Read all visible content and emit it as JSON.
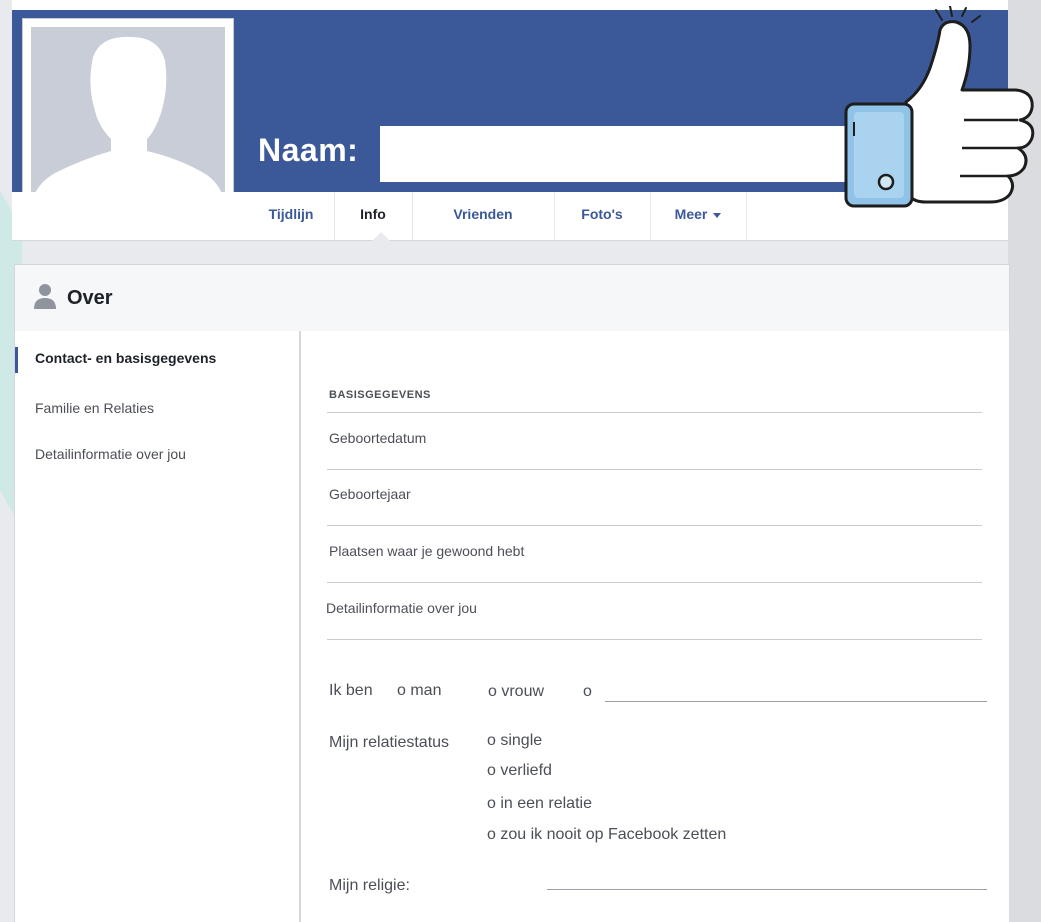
{
  "profile": {
    "name_label": "Naam:",
    "name_value": ""
  },
  "tabs": [
    {
      "label": "Tijdlijn"
    },
    {
      "label": "Info"
    },
    {
      "label": "Vrienden"
    },
    {
      "label": "Foto's"
    },
    {
      "label": "Meer"
    }
  ],
  "about": {
    "title": "Over",
    "sidebar": [
      {
        "label": "Contact- en basisgegevens",
        "active": true
      },
      {
        "label": "Familie en Relaties"
      },
      {
        "label": "Detailinformatie over jou"
      }
    ],
    "section_title": "BASISGEGEVENS",
    "fields": [
      {
        "label": "Geboortedatum"
      },
      {
        "label": "Geboortejaar"
      },
      {
        "label": "Plaatsen waar je gewoond hebt"
      },
      {
        "label": "Detailinformatie over jou"
      }
    ],
    "gender": {
      "label": "Ik ben",
      "options": [
        "o man",
        "o vrouw",
        "o"
      ]
    },
    "relationship": {
      "label": "Mijn relatiestatus",
      "options": [
        "o single",
        "o verliefd",
        "o  in een relatie",
        "o zou ik nooit op Facebook zetten"
      ]
    },
    "religion": {
      "label": "Mijn religie:"
    }
  },
  "colors": {
    "brand": "#3b5998",
    "background": "#e9eaed",
    "accent_teal": "#bfe3df",
    "phone_blue": "#8fc4e8"
  },
  "icons": [
    "person-icon",
    "silhouette-avatar",
    "thumbs-up-illustration",
    "dropdown-caret-icon"
  ]
}
